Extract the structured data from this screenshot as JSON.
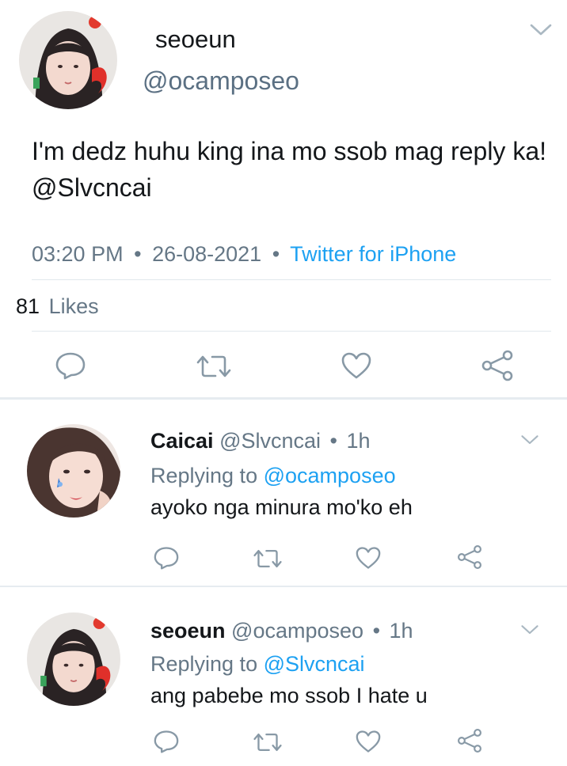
{
  "main_tweet": {
    "display_name": "seoeun",
    "handle": "@ocamposeo",
    "text": "I'm dedz huhu king ina mo ssob mag reply ka! @Slvcncai",
    "time": "03:20 PM",
    "date": "26-08-2021",
    "source": "Twitter for iPhone",
    "separator": "•",
    "likes_count": "81",
    "likes_label": "Likes"
  },
  "replies": [
    {
      "display_name": "Caicai",
      "handle": "@Slvcncai",
      "dot": "•",
      "time_ago": "1h",
      "replying_label": "Replying to",
      "replying_to": "@ocamposeo",
      "text": "ayoko nga minura mo'ko eh"
    },
    {
      "display_name": "seoeun",
      "handle": "@ocamposeo",
      "dot": "•",
      "time_ago": "1h",
      "replying_label": "Replying to",
      "replying_to": "@Slvcncai",
      "text": "ang pabebe mo ssob I hate u"
    }
  ],
  "icons": {
    "reply": "reply-icon",
    "retweet": "retweet-icon",
    "like": "heart-icon",
    "share": "share-icon",
    "menu": "chevron-down-icon"
  },
  "colors": {
    "link": "#1da1f2",
    "secondary_text": "#657786",
    "icon": "#657786",
    "divider": "#e1e8ed"
  }
}
